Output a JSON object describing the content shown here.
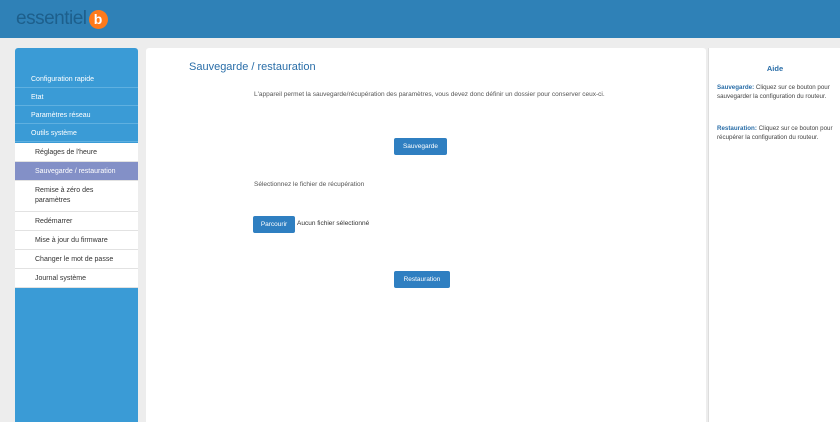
{
  "brand": {
    "text": "essentiel",
    "mark": "b"
  },
  "colors": {
    "topbar": "#2f81b7",
    "sidebar": "#3a9bd6",
    "active_item": "#8390c7",
    "button": "#2f7fc1",
    "accent_text": "#2a6ea8",
    "logo_orange": "#ff7a1a"
  },
  "sidebar": {
    "items": [
      {
        "label": "Configuration rapide"
      },
      {
        "label": "Etat"
      },
      {
        "label": "Paramètres réseau"
      },
      {
        "label": "Outils système"
      }
    ],
    "subitems": [
      {
        "label": "Réglages de l'heure",
        "active": false
      },
      {
        "label": "Sauvegarde / restauration",
        "active": true
      },
      {
        "label": "Remise à zéro des paramètres",
        "active": false
      },
      {
        "label": "Redémarrer",
        "active": false
      },
      {
        "label": "Mise à jour du firmware",
        "active": false
      },
      {
        "label": "Changer le mot de passe",
        "active": false
      },
      {
        "label": "Journal système",
        "active": false
      }
    ]
  },
  "main": {
    "title": "Sauvegarde / restauration",
    "description": "L'appareil permet la sauvegarde/récupération des paramètres, vous devez donc définir un dossier pour conserver ceux-ci.",
    "save_button": "Sauvegarde",
    "select_label": "Sélectionnez le fichier de récupération",
    "browse_button": "Parcourir",
    "file_status": "Aucun fichier sélectionné",
    "restore_button": "Restauration"
  },
  "help": {
    "title": "Aide",
    "save_term": "Sauvegarde:",
    "save_text": " Cliquez sur ce bouton pour sauvegarder la configuration du routeur.",
    "restore_term": "Restauration:",
    "restore_text": " Cliquez sur ce bouton pour récupérer la configuration du routeur."
  }
}
